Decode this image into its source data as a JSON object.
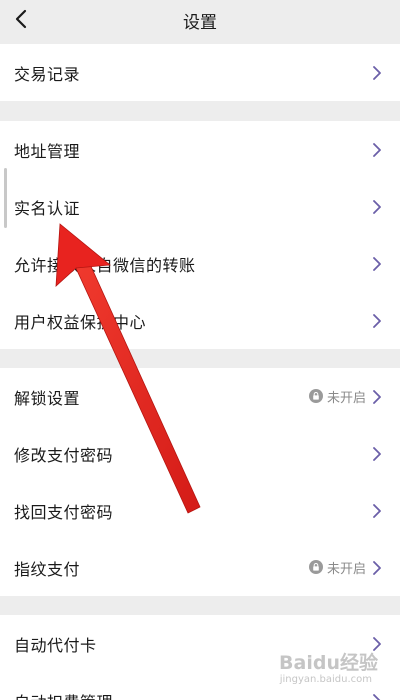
{
  "header": {
    "title": "设置",
    "back_icon": "chevron-left-icon"
  },
  "rows": [
    {
      "label": "交易记录"
    },
    {
      "label": "地址管理"
    },
    {
      "label": "实名认证"
    },
    {
      "label": "允许接收来自微信的转账"
    },
    {
      "label": "用户权益保护中心"
    },
    {
      "label": "解锁设置",
      "status": "未开启"
    },
    {
      "label": "修改支付密码"
    },
    {
      "label": "找回支付密码"
    },
    {
      "label": "指纹支付",
      "status": "未开启"
    },
    {
      "label": "自动代付卡"
    },
    {
      "label": "自动扣费管理"
    }
  ],
  "watermark": {
    "text": "Baidu经验",
    "sub": "jingyan.baidu.com"
  },
  "colors": {
    "background": "#ededed",
    "row": "#ffffff",
    "chevron": "#6b5fa8",
    "annotation_arrow": "#e8231f"
  }
}
